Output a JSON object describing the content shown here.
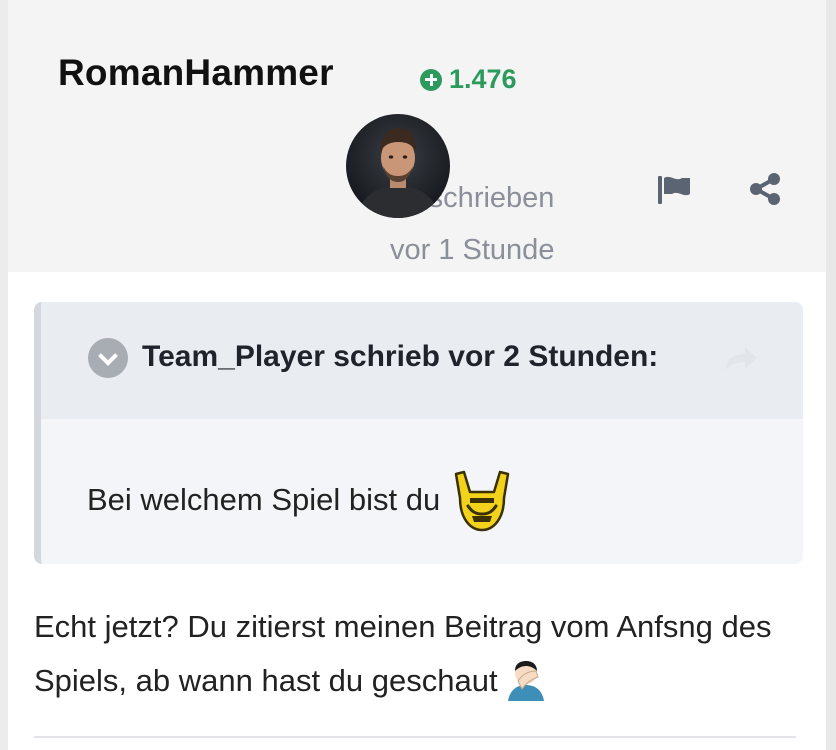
{
  "post": {
    "author": "RomanHammer",
    "reputation": "1.476",
    "date_line1": "Geschrieben",
    "date_line2": "vor 1 Stunde",
    "body": "Echt jetzt? Du zitierst meinen Beitrag vom Anfsng des Spiels, ab wann hast du geschaut",
    "body_emoji": "facepalm-emoji"
  },
  "quote": {
    "citation": "Team_Player schrieb vor 2 Stunden:",
    "text": "Bei welchem Spiel bist du",
    "emoji": "rock-on-emoji"
  },
  "icons": {
    "reputation": "plus-circle-icon",
    "report": "flag-icon",
    "share": "share-icon",
    "quote_toggle": "chevron-down-icon",
    "quote_jump": "reply-arrow-icon"
  },
  "colors": {
    "reputation": "#2c9a5c",
    "meta_text": "#8a8f99",
    "header_bg": "#f4f4f4",
    "quote_bg": "#f3f5f8",
    "quote_header_bg": "#e9edf2"
  }
}
